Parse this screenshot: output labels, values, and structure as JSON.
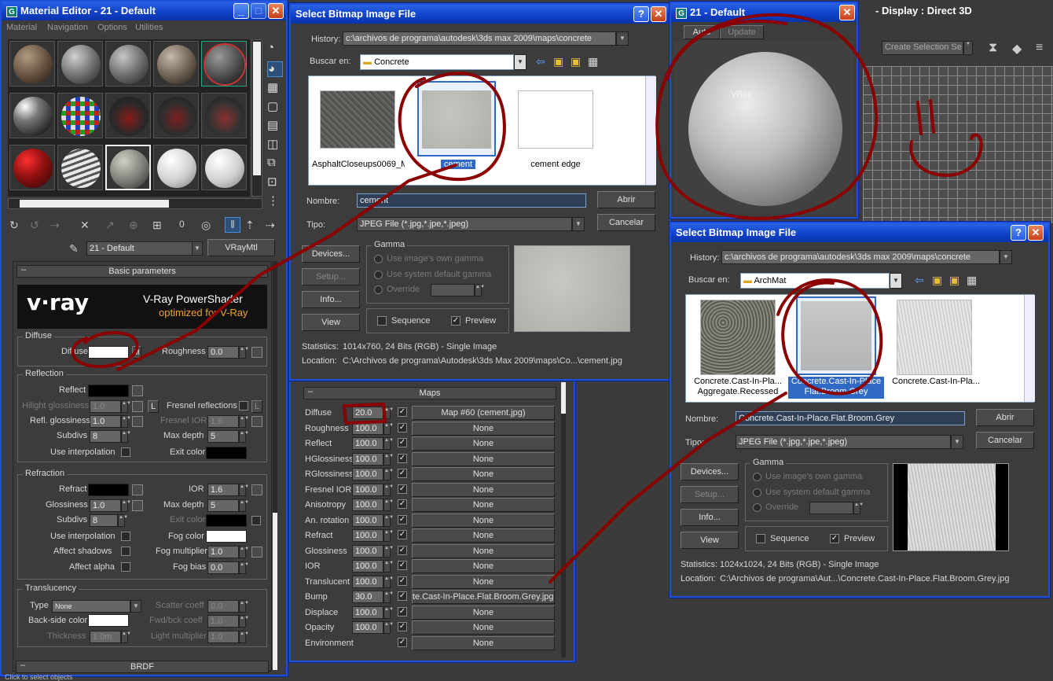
{
  "material_editor": {
    "title": "Material Editor - 21 - Default",
    "menu": [
      "Material",
      "Navigation",
      "Options",
      "Utilities"
    ],
    "material_name": "21 - Default",
    "material_type": "VRayMtl",
    "basic_params_title": "Basic parameters",
    "vray_logo": "v·ray",
    "vray_banner_line1": "V-Ray PowerShader",
    "vray_banner_line2": "optimized for V-Ray",
    "diffuse": {
      "group": "Diffuse",
      "diffuse_label": "Diffuse",
      "roughness_label": "Roughness",
      "roughness_value": "0.0"
    },
    "reflection": {
      "group": "Reflection",
      "reflect_label": "Reflect",
      "hilight_label": "Hilight glossiness",
      "hilight_value": "1.0",
      "fresnel_label": "Fresnel reflections",
      "refl_gloss_label": "Refl. glossiness",
      "refl_gloss_value": "1.0",
      "fresnel_ior_label": "Fresnel IOR",
      "fresnel_ior_value": "1.6",
      "subdivs_label": "Subdivs",
      "subdivs_value": "8",
      "max_depth_label": "Max depth",
      "max_depth_value": "5",
      "use_interp_label": "Use interpolation",
      "exit_color_label": "Exit color"
    },
    "refraction": {
      "group": "Refraction",
      "refract_label": "Refract",
      "ior_label": "IOR",
      "ior_value": "1.6",
      "glossiness_label": "Glossiness",
      "glossiness_value": "1.0",
      "max_depth_label": "Max depth",
      "max_depth_value": "5",
      "subdivs_label": "Subdivs",
      "subdivs_value": "8",
      "exit_color_label": "Exit color",
      "use_interp_label": "Use interpolation",
      "fog_color_label": "Fog color",
      "affect_shadows_label": "Affect shadows",
      "fog_mult_label": "Fog multiplier",
      "fog_mult_value": "1.0",
      "affect_alpha_label": "Affect alpha",
      "fog_bias_label": "Fog bias",
      "fog_bias_value": "0.0"
    },
    "translucency": {
      "group": "Translucency",
      "type_label": "Type",
      "type_value": "None",
      "scatter_label": "Scatter coeff",
      "scatter_value": "0.0",
      "backside_label": "Back-side color",
      "fwd_label": "Fwd/bck coeff",
      "fwd_value": "1.0",
      "thickness_label": "Thickness",
      "thickness_value": "1.0m",
      "light_mult_label": "Light multiplier",
      "light_mult_value": "1.0"
    },
    "brdf_title": "BRDF",
    "status": "Click to select objects"
  },
  "maps_panel": {
    "title": "Maps",
    "rows": [
      {
        "name": "Diffuse",
        "value": "20.0",
        "map": "Map #60 (cement.jpg)"
      },
      {
        "name": "Roughness",
        "value": "100.0",
        "map": "None"
      },
      {
        "name": "Reflect",
        "value": "100.0",
        "map": "None"
      },
      {
        "name": "HGlossiness",
        "value": "100.0",
        "map": "None"
      },
      {
        "name": "RGlossiness",
        "value": "100.0",
        "map": "None"
      },
      {
        "name": "Fresnel IOR",
        "value": "100.0",
        "map": "None"
      },
      {
        "name": "Anisotropy",
        "value": "100.0",
        "map": "None"
      },
      {
        "name": "An. rotation",
        "value": "100.0",
        "map": "None"
      },
      {
        "name": "Refract",
        "value": "100.0",
        "map": "None"
      },
      {
        "name": "Glossiness",
        "value": "100.0",
        "map": "None"
      },
      {
        "name": "IOR",
        "value": "100.0",
        "map": "None"
      },
      {
        "name": "Translucent",
        "value": "100.0",
        "map": "None"
      },
      {
        "name": "Bump",
        "value": "30.0",
        "map": "te.Cast-In-Place.Flat.Broom.Grey.jpg)"
      },
      {
        "name": "Displace",
        "value": "100.0",
        "map": "None"
      },
      {
        "name": "Opacity",
        "value": "100.0",
        "map": "None"
      },
      {
        "name": "Environment",
        "value": "",
        "map": "None"
      }
    ]
  },
  "dialog1": {
    "title": "Select Bitmap Image File",
    "history_label": "History:",
    "history_value": "c:\\archivos de programa\\autodesk\\3ds max 2009\\maps\\concrete",
    "lookin_label": "Buscar en:",
    "lookin_value": "Concrete",
    "files": [
      "AsphaltCloseups0069_M",
      "cement",
      "cement edge"
    ],
    "name_label": "Nombre:",
    "name_value": "cement",
    "type_label": "Tipo:",
    "type_value": "JPEG File (*.jpg,*.jpe,*.jpeg)",
    "open": "Abrir",
    "cancel": "Cancelar",
    "devices": "Devices...",
    "setup": "Setup...",
    "info": "Info...",
    "view": "View",
    "gamma_title": "Gamma",
    "gamma_opt1": "Use image's own gamma",
    "gamma_opt2": "Use system default gamma",
    "gamma_opt3": "Override",
    "sequence": "Sequence",
    "preview": "Preview",
    "statistics_label": "Statistics:",
    "statistics_value": "1014x760, 24 Bits (RGB) - Single Image",
    "location_label": "Location:",
    "location_value": "C:\\Archivos de programa\\Autodesk\\3ds Max 2009\\maps\\Co...\\cement.jpg"
  },
  "preview_window": {
    "title": "21 - Default",
    "tab_auto": "Auto",
    "tab_update": "Update",
    "sphere_label": "VRay"
  },
  "viewport": {
    "title": "- Display : Direct 3D",
    "selection_set": "Create Selection Se"
  },
  "dialog2": {
    "title": "Select Bitmap Image File",
    "history_label": "History:",
    "history_value": "c:\\archivos de programa\\autodesk\\3ds max 2009\\maps\\concrete",
    "lookin_label": "Buscar en:",
    "lookin_value": "ArchMat",
    "files": [
      "Concrete.Cast-In-Pla... Aggregate.Recessed",
      "Concrete.Cast-In-Place Flat.Broom.Grey",
      "Concrete.Cast-In-Pla..."
    ],
    "name_label": "Nombre:",
    "name_value": "Concrete.Cast-In-Place.Flat.Broom.Grey",
    "type_label": "Tipo:",
    "type_value": "JPEG File (*.jpg,*.jpe,*.jpeg)",
    "open": "Abrir",
    "cancel": "Cancelar",
    "devices": "Devices...",
    "setup": "Setup...",
    "info": "Info...",
    "view": "View",
    "gamma_title": "Gamma",
    "gamma_opt1": "Use image's own gamma",
    "gamma_opt2": "Use system default gamma",
    "gamma_opt3": "Override",
    "sequence": "Sequence",
    "preview": "Preview",
    "statistics_label": "Statistics:",
    "statistics_value": "1024x1024, 24 Bits (RGB) - Single Image",
    "location_label": "Location:",
    "location_value": "C:\\Archivos de programa\\Aut...\\Concrete.Cast-In-Place.Flat.Broom.Grey.jpg"
  },
  "colors": {
    "xp_title": "#0f40c8",
    "panel": "#3c3c3c",
    "ink": "#8b0000"
  }
}
